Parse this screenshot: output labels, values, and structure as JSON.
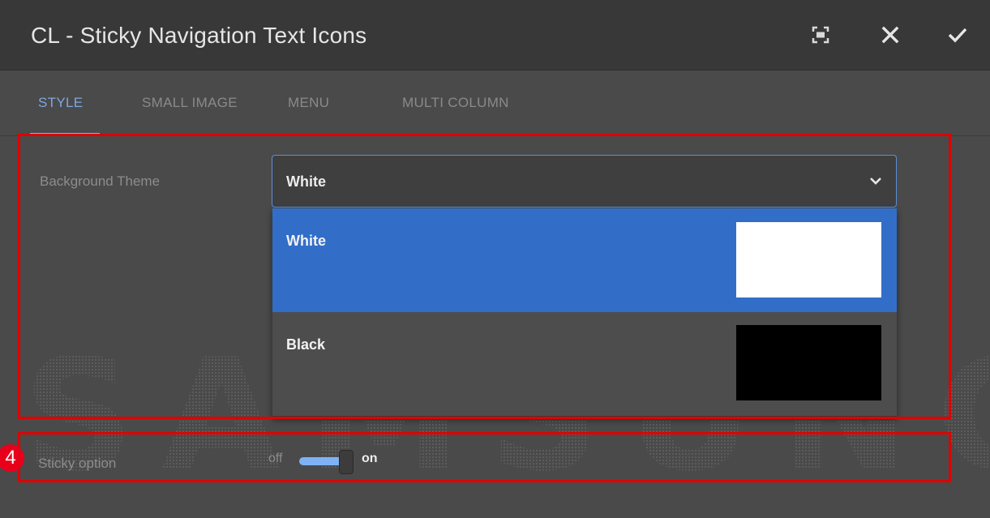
{
  "dialog": {
    "title": "CL - Sticky Navigation Text Icons",
    "actions": {
      "fullscreen_icon": "fullscreen-icon",
      "close_icon": "close-icon",
      "confirm_icon": "checkmark-icon"
    }
  },
  "tabs": [
    {
      "label": "STYLE",
      "active": true
    },
    {
      "label": "SMALL IMAGE",
      "active": false
    },
    {
      "label": "MENU",
      "active": false
    },
    {
      "label": "MULTI COLUMN",
      "active": false
    }
  ],
  "watermark": "SAMSUNG",
  "background_theme": {
    "label": "Background Theme",
    "selected_value": "White",
    "options": [
      {
        "label": "White",
        "swatch_color": "#ffffff",
        "selected": true
      },
      {
        "label": "Black",
        "swatch_color": "#000000",
        "selected": false
      }
    ]
  },
  "annotation": {
    "number": "4",
    "color": "#e8001b",
    "box_color": "#e00000"
  },
  "sticky_option": {
    "label": "Sticky option",
    "off_label": "off",
    "on_label": "on",
    "state": "on"
  },
  "colors": {
    "accent": "#326ec8",
    "tab_active": "#7ea6e0",
    "dialog_bg": "#4a4a4a",
    "titlebar_bg": "#383838"
  }
}
